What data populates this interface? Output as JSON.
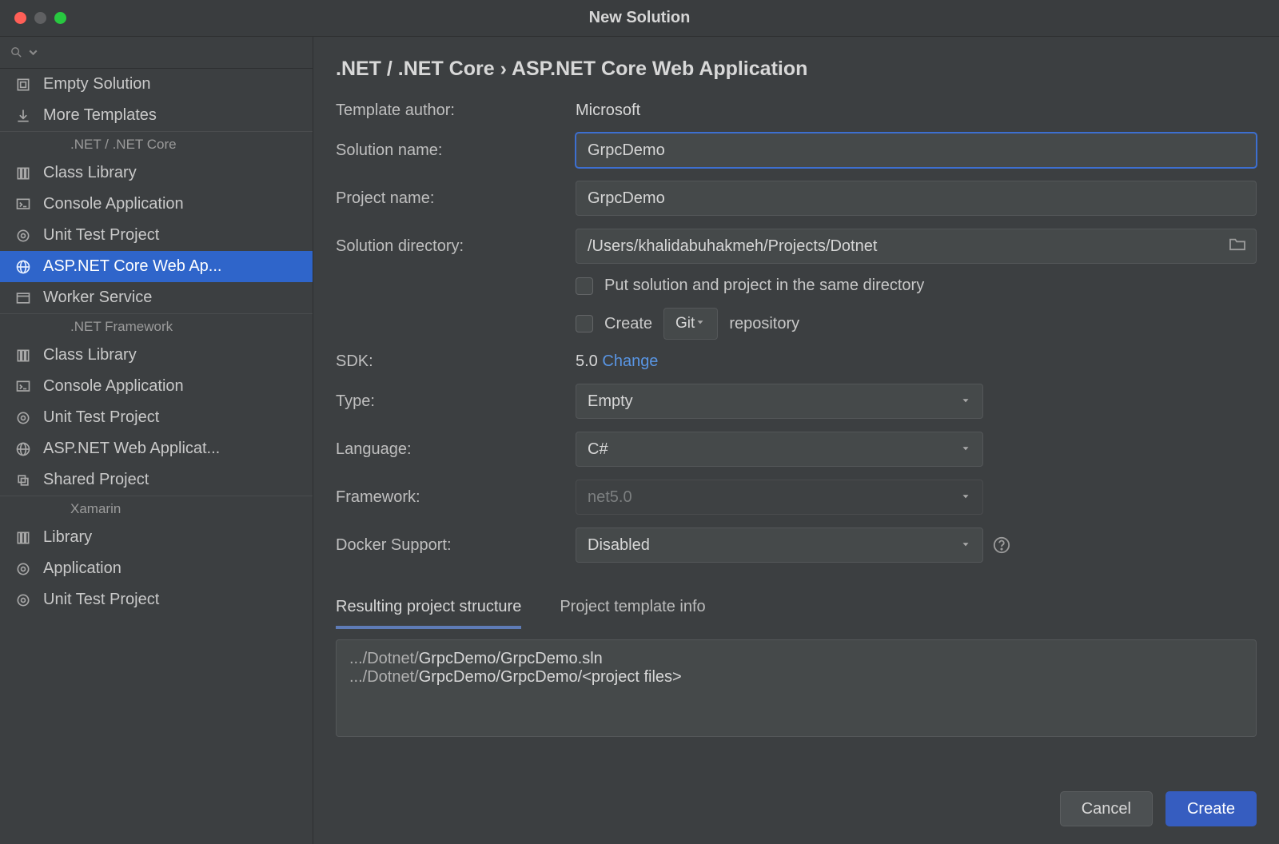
{
  "window": {
    "title": "New Solution"
  },
  "search": {
    "placeholder": ""
  },
  "sidebar": {
    "items": [
      {
        "label": "Empty Solution",
        "icon": "solution"
      },
      {
        "label": "More Templates",
        "icon": "download"
      }
    ],
    "groups": [
      {
        "title": ".NET / .NET Core",
        "items": [
          {
            "label": "Class Library",
            "icon": "library"
          },
          {
            "label": "Console Application",
            "icon": "console"
          },
          {
            "label": "Unit Test Project",
            "icon": "test"
          },
          {
            "label": "ASP.NET Core Web Ap...",
            "icon": "web",
            "selected": true
          },
          {
            "label": "Worker Service",
            "icon": "window"
          }
        ]
      },
      {
        "title": ".NET Framework",
        "items": [
          {
            "label": "Class Library",
            "icon": "library"
          },
          {
            "label": "Console Application",
            "icon": "console"
          },
          {
            "label": "Unit Test Project",
            "icon": "test"
          },
          {
            "label": "ASP.NET Web Applicat...",
            "icon": "web"
          },
          {
            "label": "Shared Project",
            "icon": "shared"
          }
        ]
      },
      {
        "title": "Xamarin",
        "items": [
          {
            "label": "Library",
            "icon": "library"
          },
          {
            "label": "Application",
            "icon": "test"
          },
          {
            "label": "Unit Test Project",
            "icon": "test"
          }
        ]
      }
    ]
  },
  "breadcrumb": {
    "path": ".NET / .NET Core",
    "leaf": "ASP.NET Core Web Application",
    "sep": "›"
  },
  "form": {
    "template_author_label": "Template author:",
    "template_author_value": "Microsoft",
    "solution_name_label": "Solution name:",
    "solution_name_value": "GrpcDemo",
    "project_name_label": "Project name:",
    "project_name_value": "GrpcDemo",
    "solution_dir_label": "Solution directory:",
    "solution_dir_value": "/Users/khalidabuhakmeh/Projects/Dotnet",
    "put_same_dir_label": "Put solution and project in the same directory",
    "create_label": "Create",
    "vcs_option": "Git",
    "repository_label": "repository",
    "sdk_label": "SDK:",
    "sdk_value": "5.0",
    "sdk_change": "Change",
    "type_label": "Type:",
    "type_value": "Empty",
    "language_label": "Language:",
    "language_value": "C#",
    "framework_label": "Framework:",
    "framework_value": "net5.0",
    "docker_label": "Docker Support:",
    "docker_value": "Disabled"
  },
  "tabs": {
    "structure": "Resulting project structure",
    "info": "Project template info"
  },
  "result": {
    "line1_prefix": ".../Dotnet/",
    "line1_hl": "GrpcDemo/GrpcDemo.sln",
    "line2_prefix": ".../Dotnet/",
    "line2_hl": "GrpcDemo/GrpcDemo/<project files>"
  },
  "buttons": {
    "cancel": "Cancel",
    "create": "Create"
  }
}
